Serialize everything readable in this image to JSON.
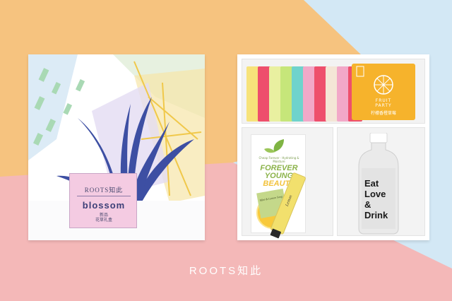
{
  "scene": {
    "colors": {
      "bg_yellow": "#f6c37f",
      "bg_blue": "#d3e8f5",
      "bg_pink": "#f4b8b8",
      "fruit_pack": "#f6b32c",
      "booklet_label": "#f4cbe2"
    }
  },
  "booklet": {
    "brand": "ROOTS知此",
    "title": "blossom",
    "subtitle_line1": "新品",
    "subtitle_line2": "花草礼盒"
  },
  "fruit_pack": {
    "title_line1": "FRUIT",
    "title_line2": "PARTY",
    "name_cn": "柠檬香橙草莓"
  },
  "mask": {
    "small_text": "Cheap Forever · Hydrating & Moisture",
    "line1": "FOREVER",
    "line2": "YOUNG",
    "line3": "BEAUTY"
  },
  "soap": {
    "label": "Mint & Lemon Song"
  },
  "hand_cream": {
    "label": "Lemon"
  },
  "bottle": {
    "line1": "Eat",
    "line2": "Love",
    "line3": "&",
    "line4": "Drink"
  },
  "footer": {
    "brand": "ROOTS知此"
  }
}
